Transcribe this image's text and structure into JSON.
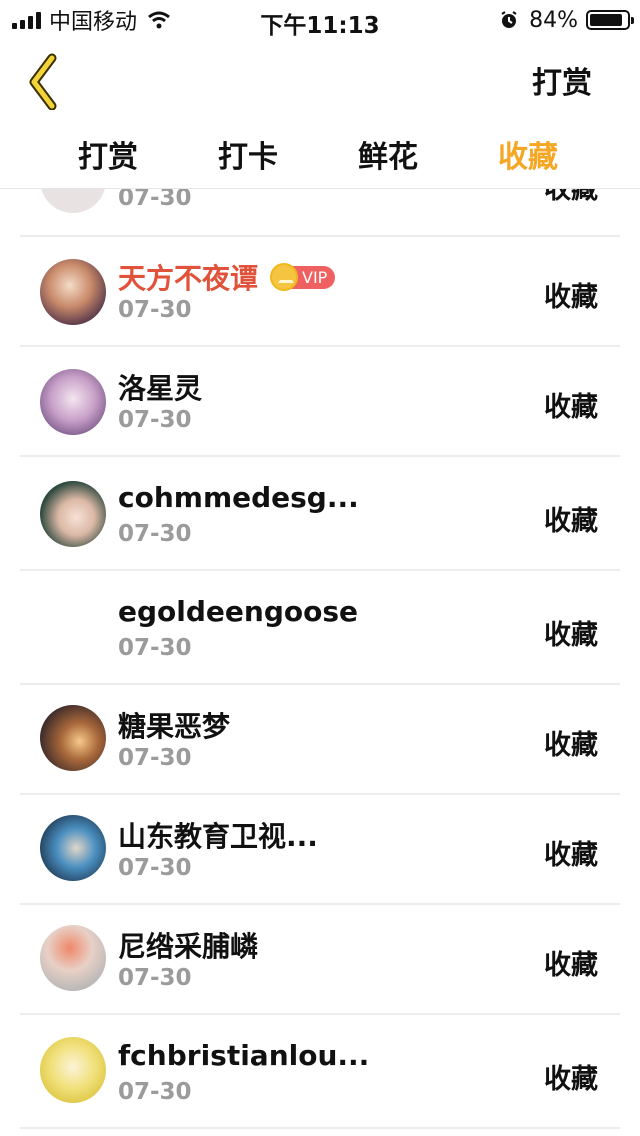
{
  "status_bar": {
    "carrier": "中国移动",
    "time": "下午11:13",
    "battery": "84%"
  },
  "nav": {
    "title": "打赏"
  },
  "tabs": [
    {
      "label": "打赏"
    },
    {
      "label": "打卡"
    },
    {
      "label": "鲜花"
    },
    {
      "label": "收藏"
    }
  ],
  "active_tab": "收藏",
  "colors": {
    "accent": "#f5a623",
    "vip_name": "#e0533a",
    "date": "#9b9b9b"
  },
  "vip_badge": "VIP",
  "list": [
    {
      "name": "",
      "date": "07-30",
      "action": "收藏"
    },
    {
      "name": "天方不夜谭",
      "date": "07-30",
      "action": "收藏",
      "vip": true
    },
    {
      "name": "洛星灵",
      "date": "07-30",
      "action": "收藏"
    },
    {
      "name": "cohmmedesg...",
      "date": "07-30",
      "action": "收藏"
    },
    {
      "name": "egoldeengoose",
      "date": "07-30",
      "action": "收藏"
    },
    {
      "name": "糖果恶梦",
      "date": "07-30",
      "action": "收藏"
    },
    {
      "name": "山东教育卫视...",
      "date": "07-30",
      "action": "收藏"
    },
    {
      "name": "尼绺采脯嶙",
      "date": "07-30",
      "action": "收藏"
    },
    {
      "name": "fchbristianlou...",
      "date": "07-30",
      "action": "收藏"
    }
  ]
}
